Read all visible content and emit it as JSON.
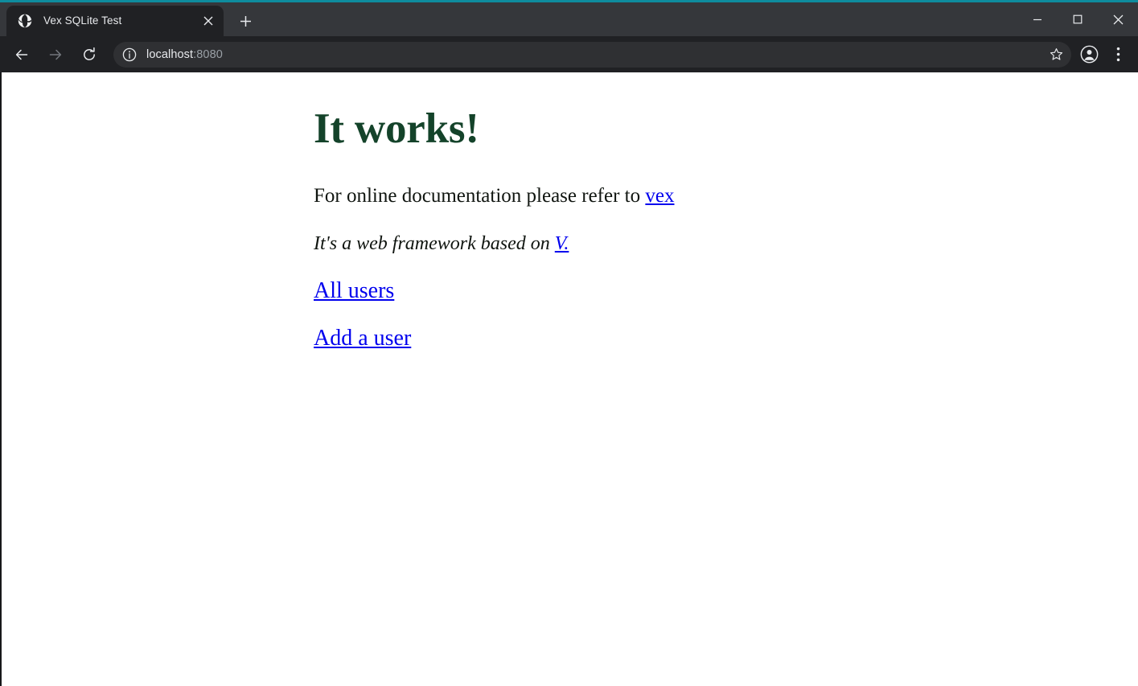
{
  "window": {
    "accent_color": "#0e8c9e",
    "controls": [
      {
        "name": "minimize",
        "glyph": "minimize-icon"
      },
      {
        "name": "maximize",
        "glyph": "maximize-icon"
      },
      {
        "name": "close",
        "glyph": "close-icon"
      }
    ]
  },
  "browser": {
    "tab": {
      "title": "Vex SQLite Test",
      "favicon": "globe-icon",
      "close_icon": "close-icon"
    },
    "new_tab_icon": "plus-icon",
    "nav": {
      "back_icon": "arrow-left-icon",
      "forward_icon": "arrow-right-icon",
      "reload_icon": "reload-icon"
    },
    "omnibox": {
      "site_info_icon": "info-circle-icon",
      "url_host": "localhost",
      "url_port": ":8080",
      "bookmark_icon": "star-icon"
    },
    "profile_icon": "account-circle-icon",
    "menu_icon": "three-dots-vertical-icon"
  },
  "page": {
    "heading": "It works!",
    "heading_color": "#14432a",
    "paragraph_prefix": "For online documentation please refer to ",
    "paragraph_link": "vex",
    "italic_prefix": "It's a web framework based on ",
    "italic_link": "V.",
    "links": [
      {
        "label": "All users"
      },
      {
        "label": "Add a user"
      }
    ],
    "link_color": "#0000ee"
  }
}
